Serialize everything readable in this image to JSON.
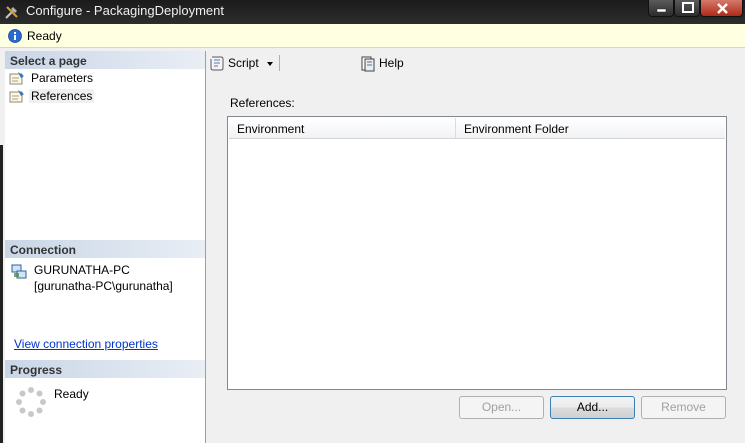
{
  "window": {
    "title": "Configure - PackagingDeployment"
  },
  "status": {
    "text": "Ready"
  },
  "left_panel": {
    "select_page_header": "Select a page",
    "pages": [
      {
        "label": "Parameters"
      },
      {
        "label": "References"
      }
    ],
    "connection_header": "Connection",
    "server": "GURUNATHA-PC",
    "user": "[gurunatha-PC\\gurunatha]",
    "view_connection_link": "View connection properties",
    "progress_header": "Progress",
    "progress_status": "Ready"
  },
  "toolbar": {
    "script_label": "Script",
    "help_label": "Help"
  },
  "main": {
    "references_label": "References:",
    "columns": [
      "Environment",
      "Environment Folder"
    ],
    "rows": []
  },
  "buttons": {
    "open": "Open...",
    "add": "Add...",
    "remove": "Remove"
  },
  "colors": {
    "status_bar": "#ffffe1",
    "section_header": "#c9d6e6",
    "link": "#0033cc"
  }
}
